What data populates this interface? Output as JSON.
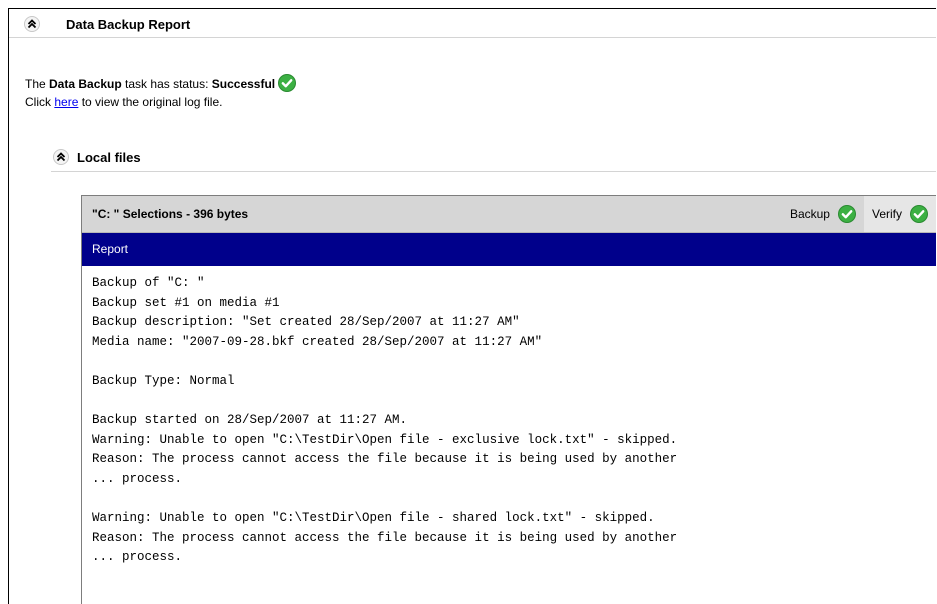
{
  "header": {
    "title": "Data Backup Report",
    "collapse_icon": "double-chevron-up-icon"
  },
  "status": {
    "prefix": "The ",
    "task_name": "Data Backup",
    "middle": " task has status: ",
    "value": "Successful",
    "icon": "success-check-icon",
    "accent": "#3cb043"
  },
  "log_link": {
    "before": "Click ",
    "link_text": "here",
    "after": " to view the original log file."
  },
  "local_files": {
    "title": "Local files"
  },
  "selection": {
    "title": "\"C: \" Selections - 396 bytes",
    "backup_label": "Backup",
    "verify_label": "Verify"
  },
  "report": {
    "title": "Report",
    "bar_color": "#00008b",
    "lines": [
      "Backup of \"C: \"",
      "Backup set #1 on media #1",
      "Backup description: \"Set created 28/Sep/2007 at 11:27 AM\"",
      "Media name: \"2007-09-28.bkf created 28/Sep/2007 at 11:27 AM\"",
      "",
      "Backup Type: Normal",
      "",
      "Backup started on 28/Sep/2007 at 11:27 AM.",
      "Warning: Unable to open \"C:\\TestDir\\Open file - exclusive lock.txt\" - skipped.",
      "Reason: The process cannot access the file because it is being used by another",
      "... process.",
      "",
      "Warning: Unable to open \"C:\\TestDir\\Open file - shared lock.txt\" - skipped.",
      "Reason: The process cannot access the file because it is being used by another",
      "... process."
    ]
  }
}
